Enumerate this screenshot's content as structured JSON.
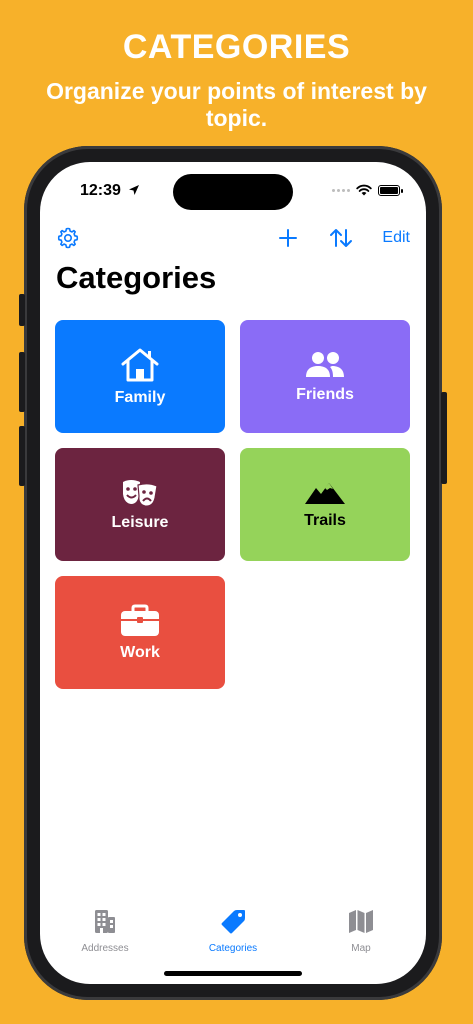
{
  "promo": {
    "title": "CATEGORIES",
    "subtitle": "Organize your points of interest by topic."
  },
  "status_bar": {
    "time": "12:39"
  },
  "toolbar": {
    "edit_label": "Edit"
  },
  "page": {
    "title": "Categories"
  },
  "categories": [
    {
      "label": "Family",
      "icon": "house-icon",
      "color": "#0A7AFF",
      "text_color": "#FFFFFF"
    },
    {
      "label": "Friends",
      "icon": "people-icon",
      "color": "#8A6CF6",
      "text_color": "#FFFFFF"
    },
    {
      "label": "Leisure",
      "icon": "theater-masks-icon",
      "color": "#6C2440",
      "text_color": "#FFFFFF"
    },
    {
      "label": "Trails",
      "icon": "mountains-icon",
      "color": "#95D35A",
      "text_color": "#000000"
    },
    {
      "label": "Work",
      "icon": "briefcase-icon",
      "color": "#E94F40",
      "text_color": "#FFFFFF"
    }
  ],
  "tabbar": {
    "items": [
      {
        "label": "Addresses",
        "icon": "building-icon",
        "active": false
      },
      {
        "label": "Categories",
        "icon": "tag-icon",
        "active": true
      },
      {
        "label": "Map",
        "icon": "map-icon",
        "active": false
      }
    ]
  },
  "colors": {
    "accent": "#0A7AFF",
    "inactive": "#8E8E93",
    "background": "#F7B12A"
  }
}
